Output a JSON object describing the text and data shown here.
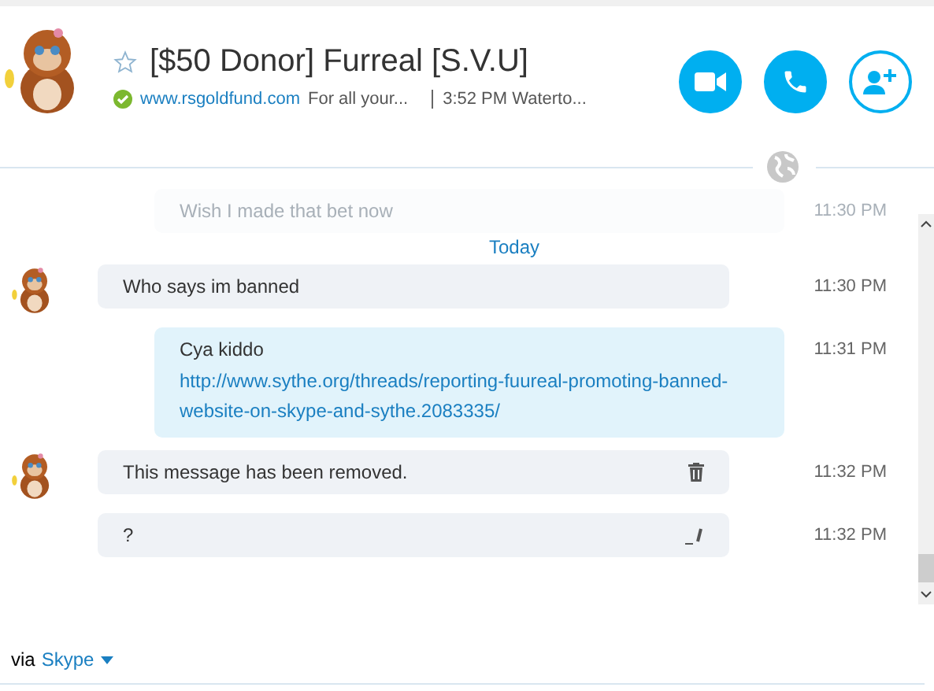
{
  "contact": {
    "name": "[$50 Donor] Furreal [S.V.U]",
    "favorite": false,
    "online": true,
    "mood_link": "www.rsgoldfund.com",
    "mood_text": "For all your...",
    "local_time": "3:52 PM Waterto..."
  },
  "actions": [
    {
      "kind": "video"
    },
    {
      "kind": "call"
    },
    {
      "kind": "add"
    }
  ],
  "messages": [
    {
      "outgoing": true,
      "kind": "text",
      "faded": true,
      "avatar": false,
      "text": "Wish I made that bet now",
      "time": "11:30 PM"
    },
    {
      "kind": "date",
      "text": "Today"
    },
    {
      "outgoing": false,
      "kind": "text",
      "faded": false,
      "avatar": true,
      "text": "Who says im banned",
      "time": "11:30 PM"
    },
    {
      "outgoing": true,
      "kind": "text",
      "faded": false,
      "avatar": false,
      "text": "Cya kiddo",
      "link": "http://www.sythe.org/threads/reporting-fuureal-promoting-banned-website-on-skype-and-sythe.2083335/",
      "time": "11:31 PM"
    },
    {
      "outgoing": false,
      "kind": "removed",
      "faded": false,
      "avatar": true,
      "text": "This message has been removed.",
      "time": "11:32 PM"
    },
    {
      "outgoing": false,
      "kind": "edited",
      "faded": false,
      "avatar": false,
      "text": "?",
      "time": "11:32 PM"
    }
  ],
  "footer": {
    "via": "via",
    "service": "Skype"
  }
}
